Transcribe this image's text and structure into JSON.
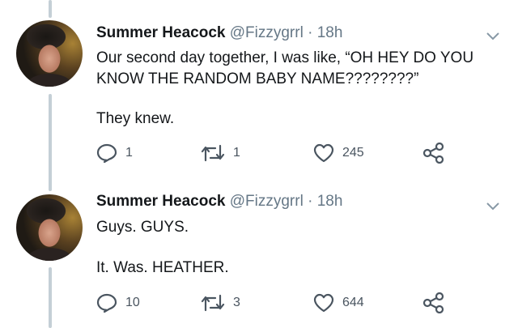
{
  "tweets": [
    {
      "author": "Summer Heacock",
      "handle": "@Fizzygrrl",
      "separator": " · ",
      "time": "18h",
      "line1": "Our second day together, I was like, “OH HEY DO YOU",
      "line2": "KNOW THE RANDOM BABY NAME????????”",
      "line3": "They knew.",
      "replies": "1",
      "retweets": "1",
      "likes": "245"
    },
    {
      "author": "Summer Heacock",
      "handle": "@Fizzygrrl",
      "separator": " · ",
      "time": "18h",
      "line1": "Guys. GUYS.",
      "line2": "It. Was. HEATHER.",
      "replies": "10",
      "retweets": "3",
      "likes": "644"
    }
  ],
  "colors": {
    "text": "#14171a",
    "secondary": "#657786",
    "icon": "#4a5560",
    "thread_line": "#c4cfd6"
  },
  "icons": [
    "reply-icon",
    "retweet-icon",
    "like-icon",
    "share-icon",
    "chevron-down-icon"
  ]
}
